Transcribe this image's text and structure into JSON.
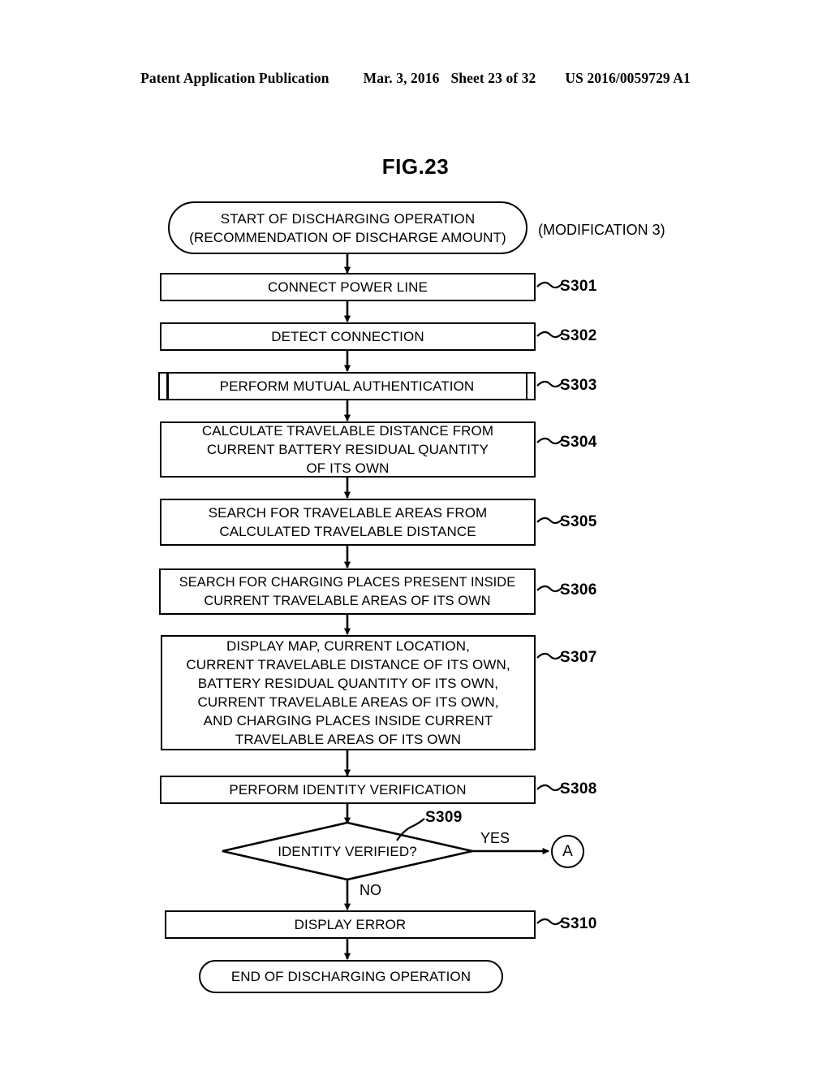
{
  "header": {
    "publication": "Patent Application Publication",
    "date": "Mar. 3, 2016",
    "sheet": "Sheet 23 of 32",
    "docnum": "US 2016/0059729 A1"
  },
  "figure": {
    "title": "FIG.23",
    "note": "(MODIFICATION 3)"
  },
  "flow": {
    "start": {
      "label": "START OF DISCHARGING OPERATION\n(RECOMMENDATION OF DISCHARGE AMOUNT)",
      "shape": "terminator"
    },
    "end": {
      "label": "END OF DISCHARGING OPERATION",
      "shape": "terminator"
    },
    "connector_a": "A",
    "steps": [
      {
        "id": "S301",
        "label": "CONNECT POWER LINE",
        "shape": "process"
      },
      {
        "id": "S302",
        "label": "DETECT CONNECTION",
        "shape": "process"
      },
      {
        "id": "S303",
        "label": "PERFORM MUTUAL AUTHENTICATION",
        "shape": "predefined"
      },
      {
        "id": "S304",
        "label": "CALCULATE TRAVELABLE DISTANCE FROM\nCURRENT BATTERY RESIDUAL QUANTITY\nOF ITS OWN",
        "shape": "process"
      },
      {
        "id": "S305",
        "label": "SEARCH FOR TRAVELABLE AREAS FROM\nCALCULATED TRAVELABLE DISTANCE",
        "shape": "process"
      },
      {
        "id": "S306",
        "label": "SEARCH FOR CHARGING PLACES PRESENT INSIDE\nCURRENT TRAVELABLE AREAS OF ITS OWN",
        "shape": "process"
      },
      {
        "id": "S307",
        "label": "DISPLAY MAP, CURRENT LOCATION,\nCURRENT TRAVELABLE DISTANCE OF ITS OWN,\nBATTERY RESIDUAL QUANTITY OF ITS OWN,\nCURRENT TRAVELABLE AREAS OF ITS OWN,\nAND CHARGING PLACES INSIDE CURRENT\nTRAVELABLE AREAS OF ITS OWN",
        "shape": "process"
      },
      {
        "id": "S308",
        "label": "PERFORM IDENTITY VERIFICATION",
        "shape": "process"
      },
      {
        "id": "S309",
        "label": "IDENTITY VERIFIED?",
        "shape": "decision"
      },
      {
        "id": "S310",
        "label": "DISPLAY ERROR",
        "shape": "process"
      }
    ],
    "branches": {
      "yes": "YES",
      "no": "NO"
    }
  }
}
